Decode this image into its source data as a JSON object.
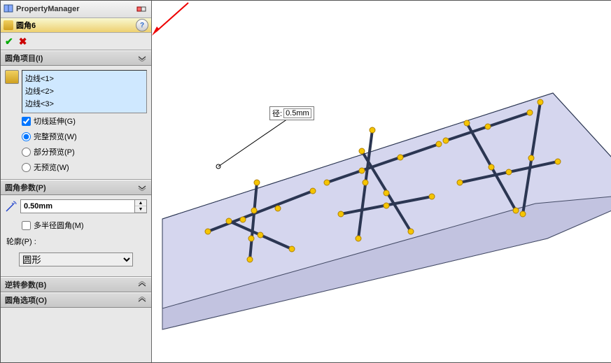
{
  "pm": {
    "title": "PropertyManager"
  },
  "feature": {
    "name": "圆角6"
  },
  "sections": {
    "items": {
      "title": "圆角项目(I)"
    },
    "params": {
      "title": "圆角参数(P)"
    },
    "invert": {
      "title": "逆转参数(B)"
    },
    "options": {
      "title": "圆角选项(O)"
    }
  },
  "edges": {
    "list": [
      "边线<1>",
      "边线<2>",
      "边线<3>"
    ]
  },
  "checks": {
    "tangent": "切线延伸(G)",
    "fullprev": "完整预览(W)",
    "partprev": "部分预览(P)",
    "noprev": "无预览(W)",
    "multir": "多半径圆角(M)"
  },
  "params": {
    "radius": "0.50mm",
    "profileLabel": "轮廓(P) :",
    "profile": "圆形"
  },
  "callout": {
    "label": "径:",
    "value": "0.5mm"
  }
}
